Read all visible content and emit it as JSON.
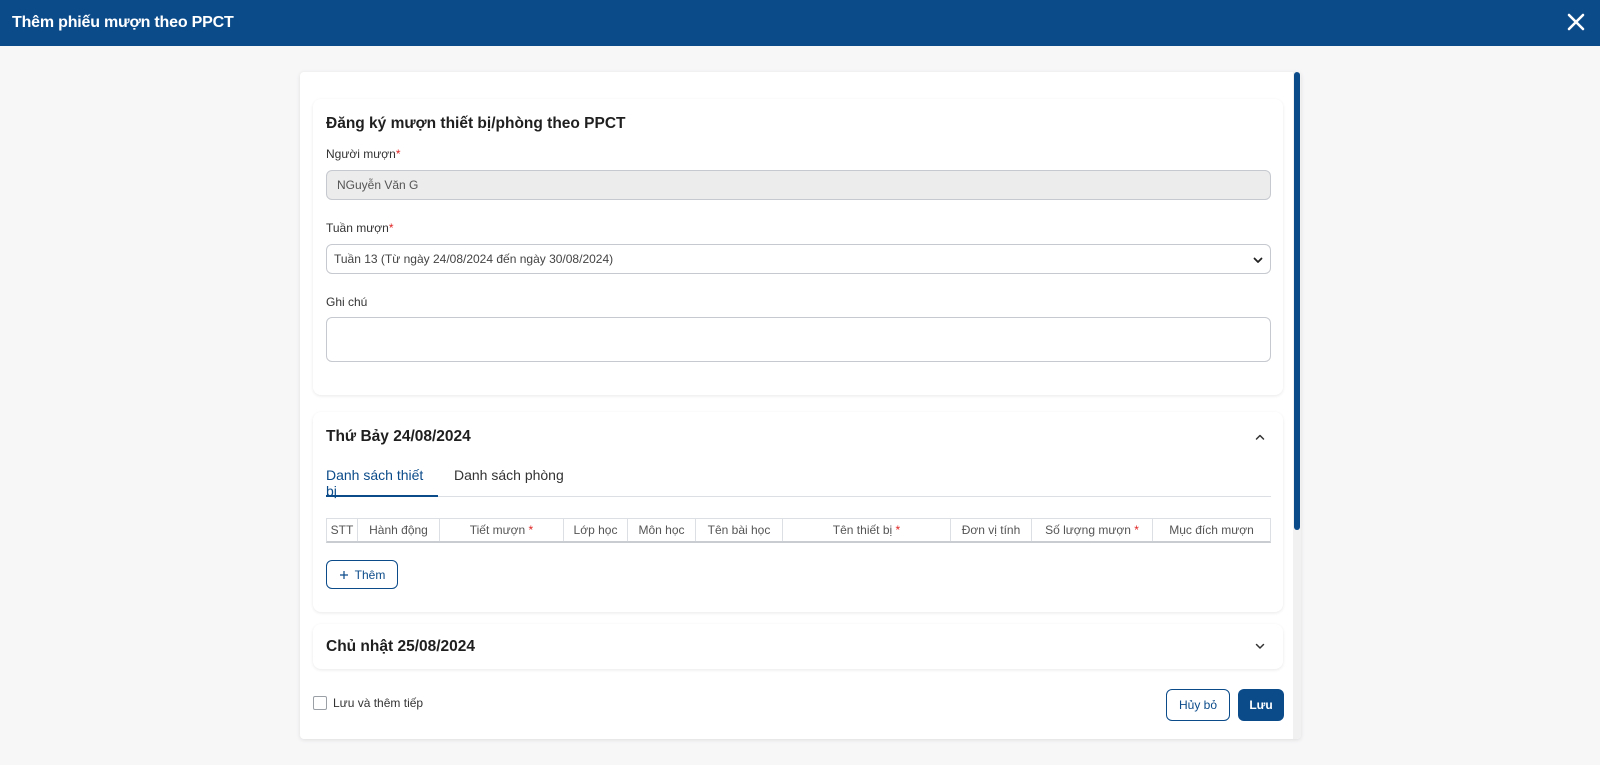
{
  "header": {
    "title": "Thêm phiếu mượn theo PPCT",
    "close_icon": "close-icon"
  },
  "form": {
    "title": "Đăng ký mượn thiết bị/phòng theo PPCT",
    "borrower": {
      "label": "Người mượn",
      "required_mark": "*",
      "value": "NGuyễn Văn G"
    },
    "week": {
      "label": "Tuần mượn",
      "required_mark": "*",
      "selected": "Tuần 13 (Từ ngày 24/08/2024 đến ngày 30/08/2024)"
    },
    "note": {
      "label": "Ghi chú",
      "value": ""
    }
  },
  "day_sections": [
    {
      "title": "Thứ Bảy 24/08/2024",
      "expanded": true,
      "tabs": [
        {
          "label": "Danh sách thiết bị",
          "active": true
        },
        {
          "label": "Danh sách phòng",
          "active": false
        }
      ],
      "columns": [
        {
          "label": "STT",
          "required": false
        },
        {
          "label": "Hành động",
          "required": false
        },
        {
          "label": "Tiết mượn",
          "required": true
        },
        {
          "label": "Lớp học",
          "required": false
        },
        {
          "label": "Môn học",
          "required": false
        },
        {
          "label": "Tên bài học",
          "required": false
        },
        {
          "label": "Tên thiết bị",
          "required": true
        },
        {
          "label": "Đơn vị tính",
          "required": false
        },
        {
          "label": "Số lượng mượn",
          "required": true
        },
        {
          "label": "Mục đích mượn",
          "required": false
        }
      ],
      "add_button": {
        "icon": "plus-icon",
        "label": "Thêm"
      }
    },
    {
      "title": "Chủ nhật 25/08/2024",
      "expanded": false
    }
  ],
  "footer": {
    "save_and_continue": {
      "label": "Lưu và thêm tiếp",
      "checked": false
    },
    "cancel_label": "Hủy bỏ",
    "save_label": "Lưu"
  },
  "colors": {
    "primary": "#0b4b8a",
    "required": "#e02424",
    "background": "#f7f7f8"
  }
}
